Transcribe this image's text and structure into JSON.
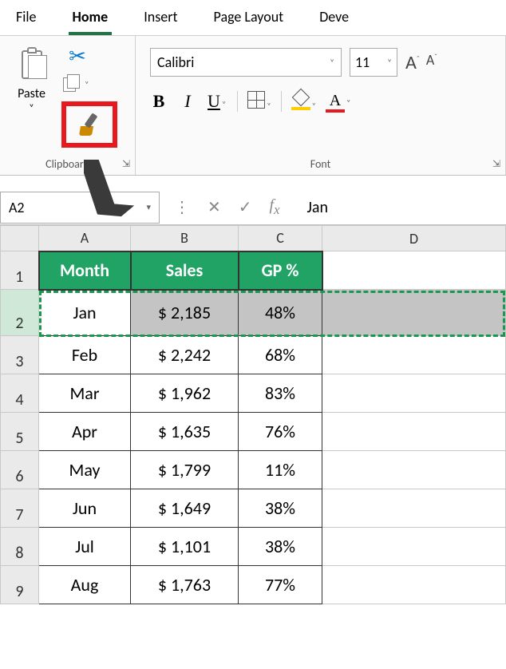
{
  "tabs": [
    "File",
    "Home",
    "Insert",
    "Page Layout",
    "Deve"
  ],
  "active_tab_index": 1,
  "clipboard": {
    "paste_label": "Paste",
    "group_label": "Clipboard"
  },
  "font": {
    "name": "Calibri",
    "size": "11",
    "group_label": "Font"
  },
  "namebox": "A2",
  "formula_value": "Jan",
  "columns": [
    "A",
    "B",
    "C",
    "D"
  ],
  "chart_data": {
    "type": "table",
    "headers": [
      "Month",
      "Sales",
      "GP %"
    ],
    "rows": [
      {
        "row": 2,
        "month": "Jan",
        "sales": "$  2,185",
        "gp": "48%"
      },
      {
        "row": 3,
        "month": "Feb",
        "sales": "$  2,242",
        "gp": "68%"
      },
      {
        "row": 4,
        "month": "Mar",
        "sales": "$  1,962",
        "gp": "83%"
      },
      {
        "row": 5,
        "month": "Apr",
        "sales": "$  1,635",
        "gp": "76%"
      },
      {
        "row": 6,
        "month": "May",
        "sales": "$  1,799",
        "gp": "11%"
      },
      {
        "row": 7,
        "month": "Jun",
        "sales": "$  1,649",
        "gp": "38%"
      },
      {
        "row": 8,
        "month": "Jul",
        "sales": "$  1,101",
        "gp": "38%"
      },
      {
        "row": 9,
        "month": "Aug",
        "sales": "$  1,763",
        "gp": "77%"
      }
    ]
  }
}
